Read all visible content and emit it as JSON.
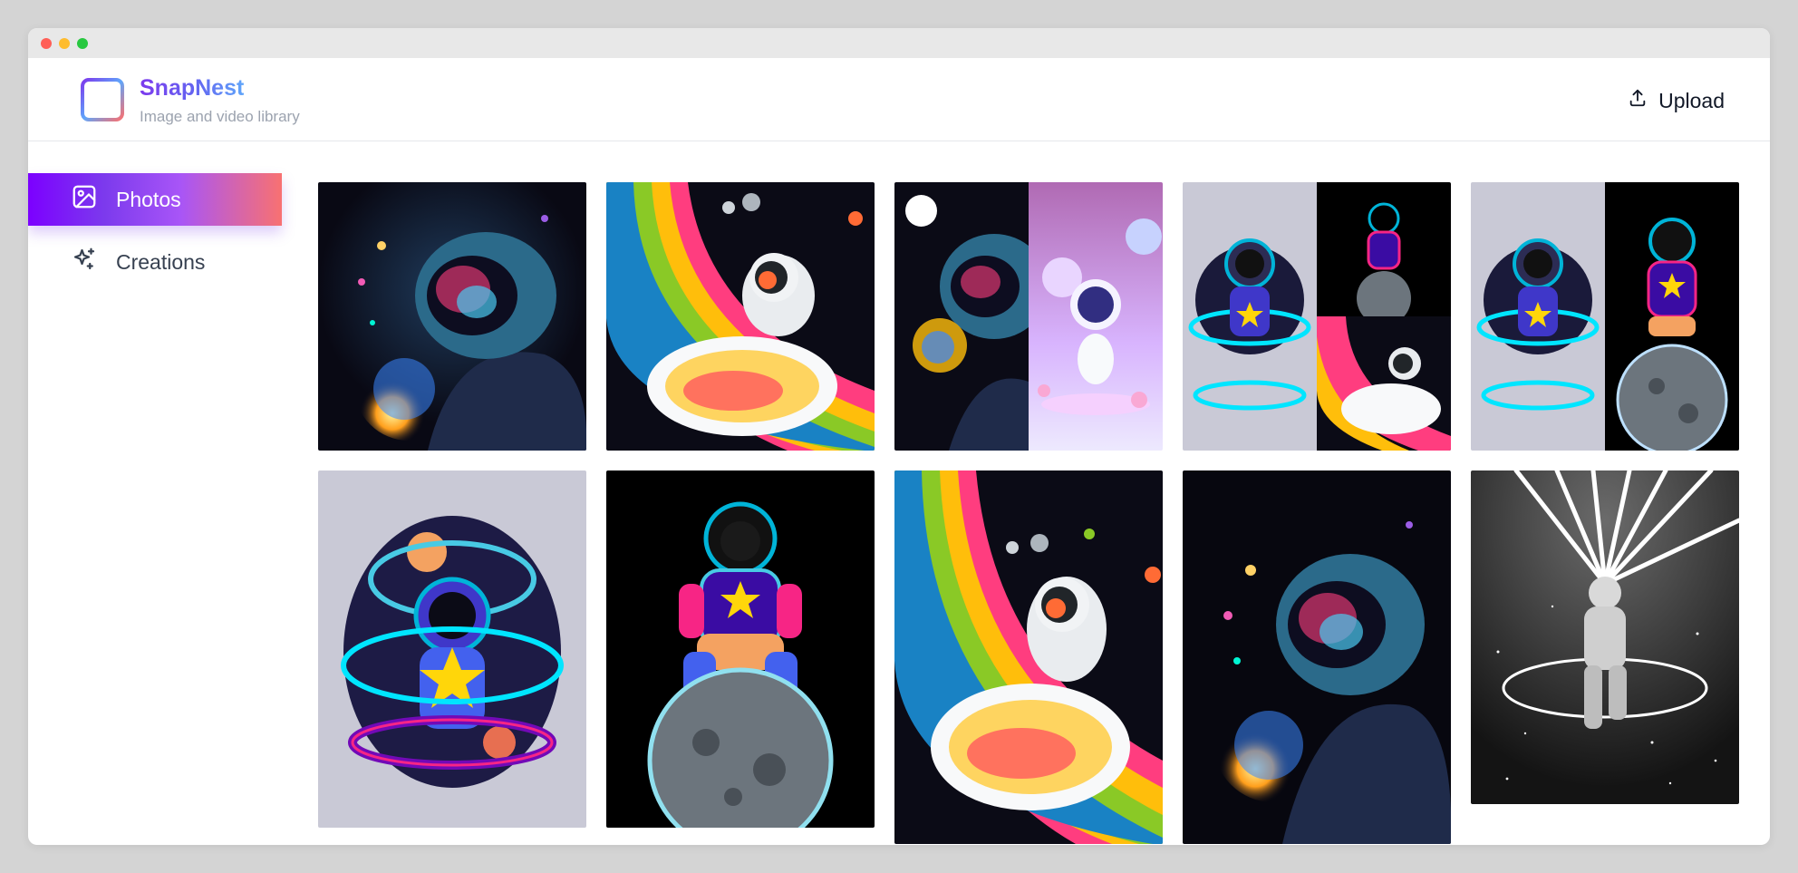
{
  "app": {
    "name": "SnapNest",
    "tagline": "Image and video library",
    "brand_gradient": [
      "#7c3aed",
      "#60a5fa"
    ]
  },
  "header": {
    "upload_label": "Upload",
    "upload_icon": "upload-icon"
  },
  "sidebar": {
    "items": [
      {
        "label": "Photos",
        "icon": "image-icon",
        "active": true
      },
      {
        "label": "Creations",
        "icon": "sparkles-icon",
        "active": false
      }
    ]
  },
  "gallery": {
    "tiles": [
      {
        "subject": "astronaut-holding-glowing-planet"
      },
      {
        "subject": "astronaut-floating-on-rainbow-planet"
      },
      {
        "subject": "split-astronaut-planet-and-cute-astronaut",
        "selectable": true
      },
      {
        "subject": "collage-neon-astronauts"
      },
      {
        "subject": "collage-neon-astronaut-on-moon"
      },
      {
        "subject": "neon-astronaut-with-star"
      },
      {
        "subject": "neon-astronaut-sitting-on-moon"
      },
      {
        "subject": "astronaut-on-rainbow-planet-large"
      },
      {
        "subject": "astronaut-holding-glowing-planet-large"
      },
      {
        "subject": "monochrome-astronaut-with-light-beams"
      }
    ]
  },
  "colors": {
    "active_nav_gradient": [
      "#7c00ff",
      "#a855f7",
      "#f87171"
    ],
    "page_background": "#d4d4d4"
  }
}
